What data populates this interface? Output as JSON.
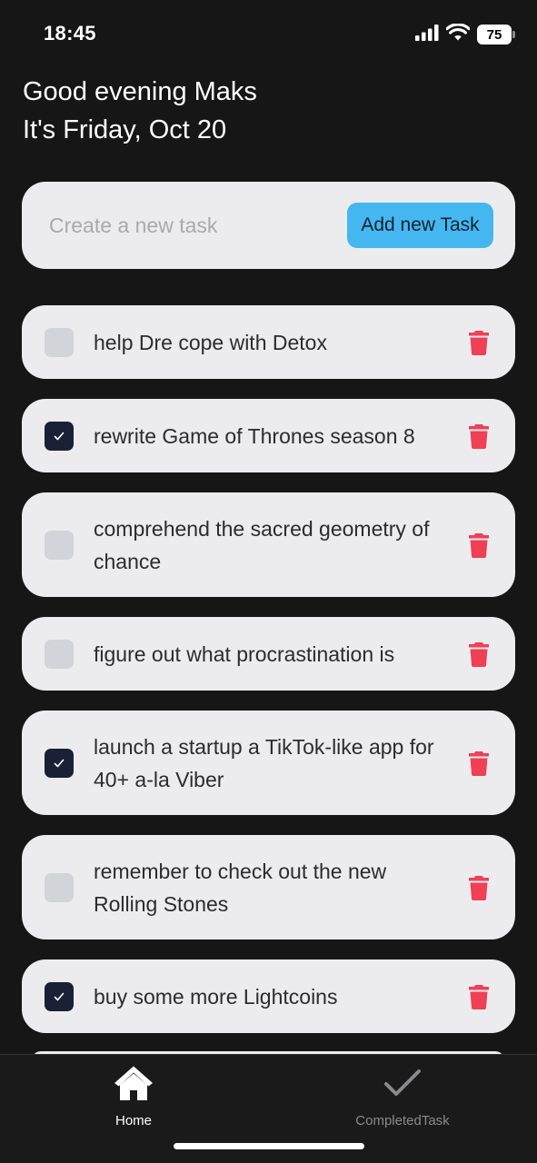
{
  "status_bar": {
    "time": "18:45",
    "battery": "75"
  },
  "greeting": {
    "line1": "Good evening Maks",
    "line2": "It's Friday, Oct 20"
  },
  "new_task": {
    "placeholder": "Create a new task",
    "button_label": "Add new Task"
  },
  "tasks": [
    {
      "text": "help Dre cope with Detox",
      "completed": false
    },
    {
      "text": "rewrite Game of Thrones season 8",
      "completed": true
    },
    {
      "text": "comprehend the sacred geometry of chance",
      "completed": false
    },
    {
      "text": "figure out what procrastination is",
      "completed": false
    },
    {
      "text": "launch a startup a TikTok-like app for 40+ a-la Viber",
      "completed": true
    },
    {
      "text": "remember to check out the new Rolling Stones",
      "completed": false
    },
    {
      "text": "buy some more Lightcoins",
      "completed": true
    }
  ],
  "tab_bar": {
    "home_label": "Home",
    "completed_label": "CompletedTask",
    "active_tab": "home"
  },
  "colors": {
    "background": "#161616",
    "card": "#ececef",
    "accent_button": "#44b7f0",
    "checkbox_checked": "#1a2035",
    "checkbox_unchecked": "#d3d4d9",
    "delete": "#ef4056"
  },
  "icons": {
    "status": [
      "cellular-signal-icon",
      "wifi-icon",
      "battery-icon"
    ],
    "task_delete": "trash-icon",
    "task_checked": "checkmark-icon",
    "tab_home": "home-icon",
    "tab_completed": "checkmark-icon"
  }
}
